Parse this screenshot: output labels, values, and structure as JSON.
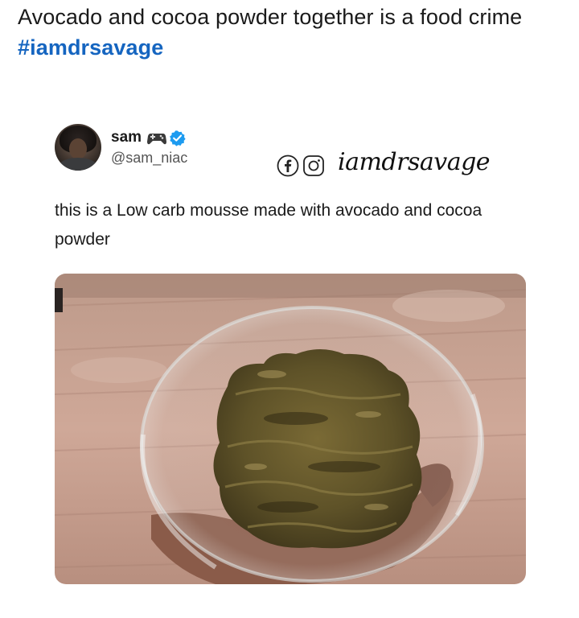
{
  "post": {
    "caption_text": "Avocado and cocoa powder together is a food crime ",
    "caption_hashtag": "#iamdrsavage"
  },
  "tweet": {
    "display_name": "sam",
    "handle": "@sam_niac",
    "text": "this is a Low carb mousse made with avocado and cocoa powder",
    "watermark": "iamdrsavage",
    "verified_color": "#1d9bf0",
    "hashtag_color": "#1565c0"
  },
  "icons": {
    "name_emoji": "gamepad-icon",
    "verified": "verified-icon",
    "watermark_social": [
      "facebook-icon",
      "instagram-icon"
    ]
  }
}
